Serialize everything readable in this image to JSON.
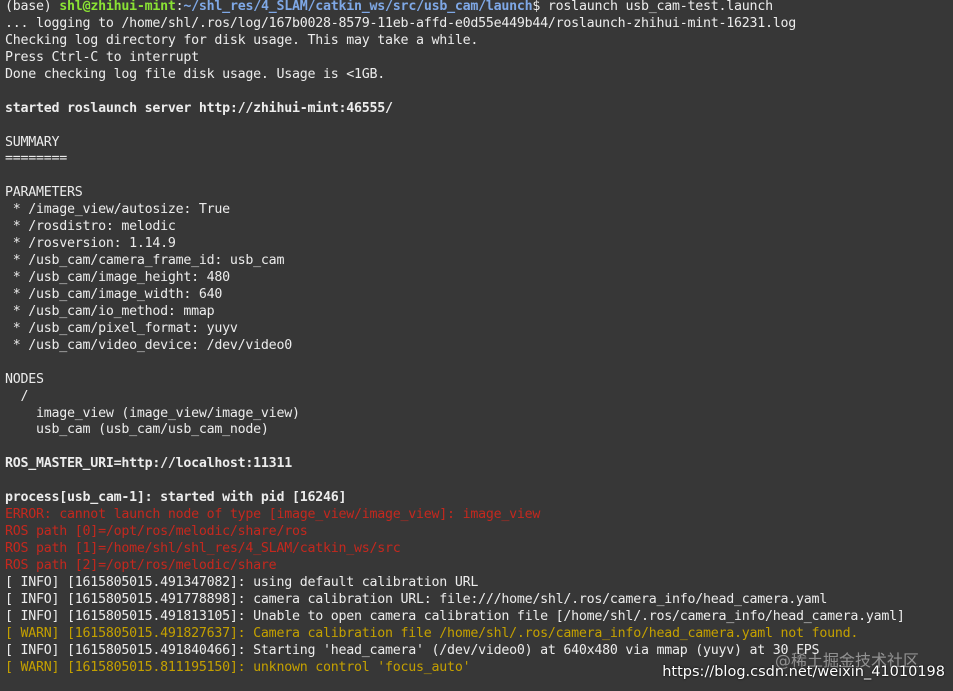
{
  "terminal": {
    "lines": [
      [
        {
          "t": "(base) ",
          "c": ""
        },
        {
          "t": "shl@zhihui-mint",
          "c": "green"
        },
        {
          "t": ":",
          "c": ""
        },
        {
          "t": "~/shl_res/4_SLAM/catkin_ws/src/usb_cam/launch",
          "c": "blue"
        },
        {
          "t": "$ roslaunch usb_cam-test.launch",
          "c": ""
        }
      ],
      [
        {
          "t": "... logging to /home/shl/.ros/log/167b0028-8579-11eb-affd-e0d55e449b44/roslaunch-zhihui-mint-16231.log",
          "c": ""
        }
      ],
      [
        {
          "t": "Checking log directory for disk usage. This may take a while.",
          "c": ""
        }
      ],
      [
        {
          "t": "Press Ctrl-C to interrupt",
          "c": ""
        }
      ],
      [
        {
          "t": "Done checking log file disk usage. Usage is <1GB.",
          "c": ""
        }
      ],
      [
        {
          "t": "",
          "c": ""
        }
      ],
      [
        {
          "t": "started roslaunch server http://zhihui-mint:46555/",
          "c": "bold"
        }
      ],
      [
        {
          "t": "",
          "c": ""
        }
      ],
      [
        {
          "t": "SUMMARY",
          "c": ""
        }
      ],
      [
        {
          "t": "========",
          "c": ""
        }
      ],
      [
        {
          "t": "",
          "c": ""
        }
      ],
      [
        {
          "t": "PARAMETERS",
          "c": ""
        }
      ],
      [
        {
          "t": " * /image_view/autosize: True",
          "c": ""
        }
      ],
      [
        {
          "t": " * /rosdistro: melodic",
          "c": ""
        }
      ],
      [
        {
          "t": " * /rosversion: 1.14.9",
          "c": ""
        }
      ],
      [
        {
          "t": " * /usb_cam/camera_frame_id: usb_cam",
          "c": ""
        }
      ],
      [
        {
          "t": " * /usb_cam/image_height: 480",
          "c": ""
        }
      ],
      [
        {
          "t": " * /usb_cam/image_width: 640",
          "c": ""
        }
      ],
      [
        {
          "t": " * /usb_cam/io_method: mmap",
          "c": ""
        }
      ],
      [
        {
          "t": " * /usb_cam/pixel_format: yuyv",
          "c": ""
        }
      ],
      [
        {
          "t": " * /usb_cam/video_device: /dev/video0",
          "c": ""
        }
      ],
      [
        {
          "t": "",
          "c": ""
        }
      ],
      [
        {
          "t": "NODES",
          "c": ""
        }
      ],
      [
        {
          "t": "  /",
          "c": ""
        }
      ],
      [
        {
          "t": "    image_view (image_view/image_view)",
          "c": ""
        }
      ],
      [
        {
          "t": "    usb_cam (usb_cam/usb_cam_node)",
          "c": ""
        }
      ],
      [
        {
          "t": "",
          "c": ""
        }
      ],
      [
        {
          "t": "ROS_MASTER_URI=http://localhost:11311",
          "c": "bold"
        }
      ],
      [
        {
          "t": "",
          "c": ""
        }
      ],
      [
        {
          "t": "process[usb_cam-1]: started with pid [16246]",
          "c": "bold"
        }
      ],
      [
        {
          "t": "ERROR: cannot launch node of type [image_view/image_view]: image_view",
          "c": "red"
        }
      ],
      [
        {
          "t": "ROS path [0]=/opt/ros/melodic/share/ros",
          "c": "red"
        }
      ],
      [
        {
          "t": "ROS path [1]=/home/shl/shl_res/4_SLAM/catkin_ws/src",
          "c": "red"
        }
      ],
      [
        {
          "t": "ROS path [2]=/opt/ros/melodic/share",
          "c": "red"
        }
      ],
      [
        {
          "t": "[ INFO] [1615805015.491347082]: using default calibration URL",
          "c": ""
        }
      ],
      [
        {
          "t": "[ INFO] [1615805015.491778898]: camera calibration URL: file:///home/shl/.ros/camera_info/head_camera.yaml",
          "c": ""
        }
      ],
      [
        {
          "t": "[ INFO] [1615805015.491813105]: Unable to open camera calibration file [/home/shl/.ros/camera_info/head_camera.yaml]",
          "c": ""
        }
      ],
      [
        {
          "t": "[ WARN] [1615805015.491827637]: Camera calibration file /home/shl/.ros/camera_info/head_camera.yaml not found.",
          "c": "yellow"
        }
      ],
      [
        {
          "t": "[ INFO] [1615805015.491840466]: Starting 'head_camera' (/dev/video0) at 640x480 via mmap (yuyv) at 30 FPS",
          "c": ""
        }
      ],
      [
        {
          "t": "[ WARN] [1615805015.811195150]: unknown control 'focus_auto'",
          "c": "yellow"
        }
      ]
    ]
  },
  "watermark": {
    "faint": "@稀土掘金技术社区",
    "url": "https://blog.csdn.net/weixin_41010198"
  }
}
